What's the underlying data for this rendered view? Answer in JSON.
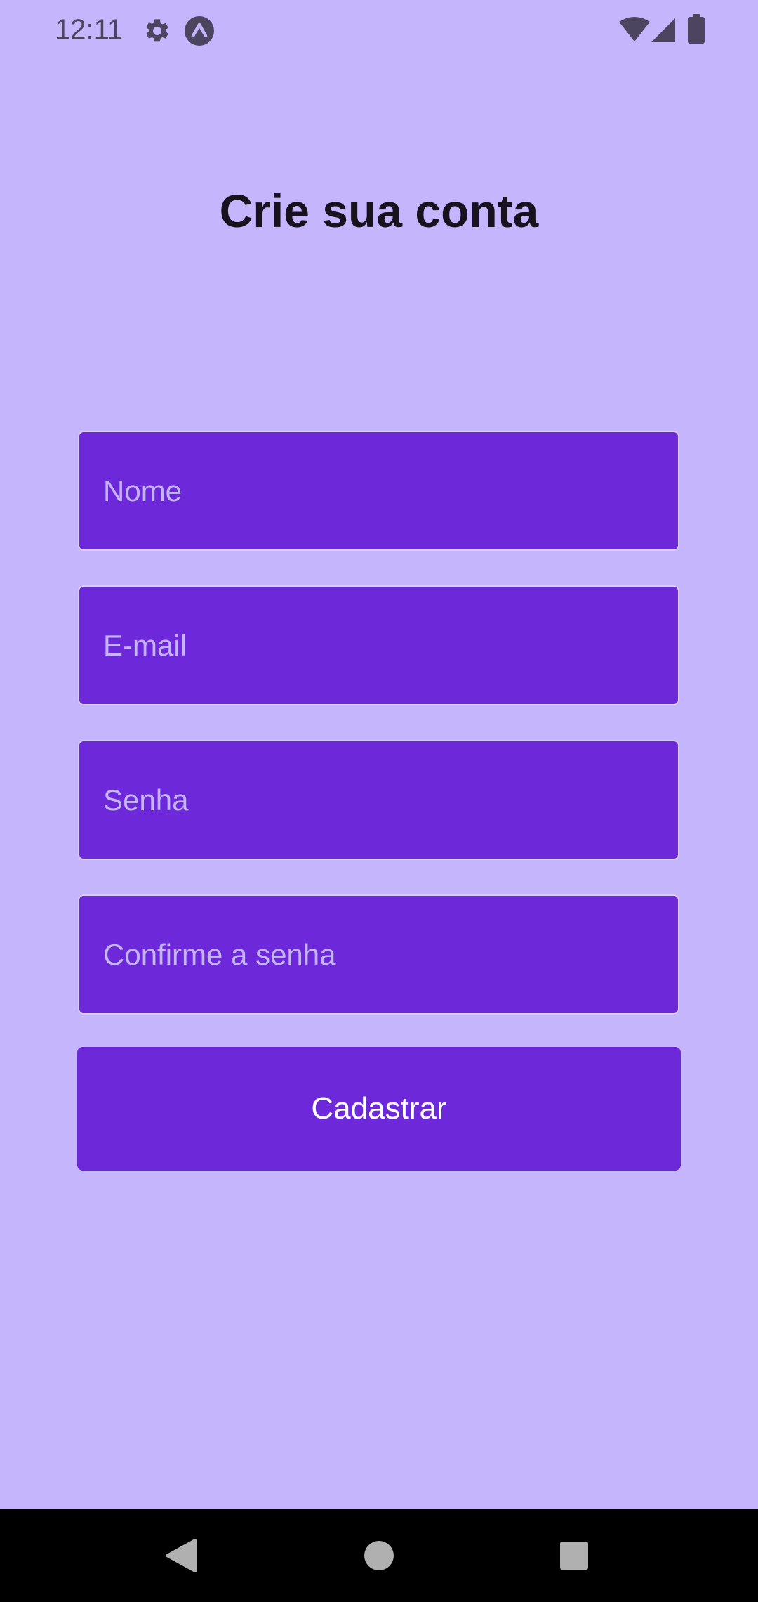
{
  "status_bar": {
    "time": "12:11",
    "icons": [
      "settings-gear-icon",
      "app-notification-icon",
      "wifi-icon",
      "cell-signal-icon",
      "battery-icon"
    ]
  },
  "page": {
    "title": "Crie sua conta"
  },
  "form": {
    "fields": [
      {
        "placeholder": "Nome",
        "value": ""
      },
      {
        "placeholder": "E-mail",
        "value": ""
      },
      {
        "placeholder": "Senha",
        "value": ""
      },
      {
        "placeholder": "Confirme a senha",
        "value": ""
      }
    ],
    "submit_label": "Cadastrar"
  },
  "nav_bar": {
    "buttons": [
      "back-icon",
      "home-icon",
      "recents-icon"
    ]
  },
  "colors": {
    "background": "#c4b5fd",
    "accent": "#6d28d9",
    "field_border": "#d9ccfb",
    "title_text": "#16121e",
    "nav_bar": "#000000"
  }
}
